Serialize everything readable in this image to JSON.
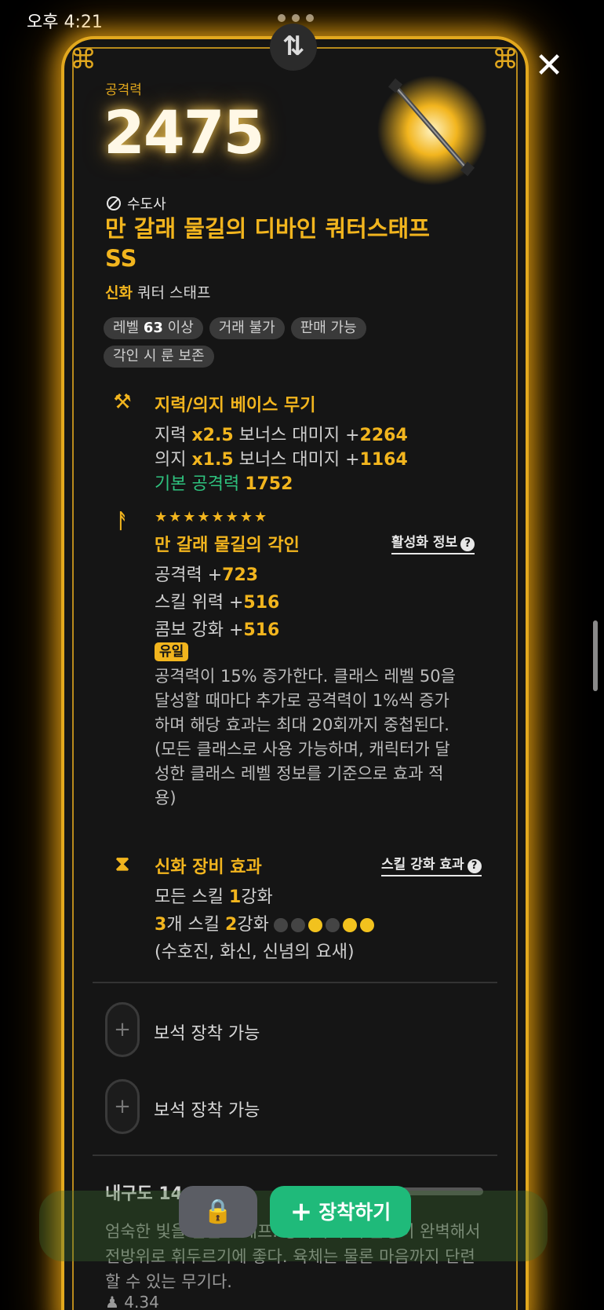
{
  "status_bar": {
    "time": "오후 4:21"
  },
  "header": {
    "swap_icon": "⇅",
    "close_icon": "✕",
    "corner_ornament": "⌘"
  },
  "item": {
    "attack_label": "공격력",
    "attack_value": "2475",
    "class_name": "수도사",
    "name": "만 갈래 물길의 디바인 쿼터스태프SS",
    "rarity": "신화",
    "type": "쿼터 스태프"
  },
  "tags": {
    "level_prefix": "레벨 ",
    "level_value": "63",
    "level_suffix": " 이상",
    "trade": "거래 불가",
    "sellable": "판매 가능",
    "rune_keep": "각인 시 룬 보존"
  },
  "base_weapon": {
    "icon": "⚒",
    "title": "지력/의지 베이스 무기",
    "line1_a": "지력 ",
    "line1_b": "x2.5",
    "line1_c": " 보너스 대미지 +",
    "line1_d": "2264",
    "line2_a": "의지 ",
    "line2_b": "x1.5",
    "line2_c": " 보너스 대미지 +",
    "line2_d": "1164",
    "line3_a": "기본 공격력 ",
    "line3_b": "1752"
  },
  "engraving": {
    "icon": "ᚨ",
    "stars": "★★★★★★★★",
    "title": "만 갈래 물길의 각인",
    "info_link": "활성화 정보",
    "help": "?",
    "stat1_a": "공격력 +",
    "stat1_b": "723",
    "stat2_a": "스킬 위력 +",
    "stat2_b": "516",
    "stat3_a": "콤보 강화 +",
    "stat3_b": "516",
    "unique_badge": "유일",
    "desc": "공격력이 15% 증가한다. 클래스 레벨 50을 달성할 때마다 추가로 공격력이 1%씩 증가하며 해당 효과는 최대 20회까지 중첩된다. (모든 클래스로 사용 가능하며, 캐릭터가 달성한 클래스 레벨 정보를 기준으로 효과 적용)"
  },
  "mythic_effect": {
    "icon": "⧗",
    "title": "신화 장비 효과",
    "info_link": "스킬 강화 효과",
    "help": "?",
    "line1_a": "모든 스킬 ",
    "line1_b": "1",
    "line1_c": "강화",
    "line2_a": "3",
    "line2_b": "개 스킬 ",
    "line2_c": "2",
    "line2_d": "강화",
    "gems": [
      false,
      false,
      true,
      false,
      true,
      true
    ],
    "skills": "(수호진, 화신, 신념의 요새)"
  },
  "sockets": [
    {
      "plus": "+",
      "label": "보석 장착 가능"
    },
    {
      "plus": "+",
      "label": "보석 장착 가능"
    }
  ],
  "durability": {
    "label": "내구도 14"
  },
  "flavor": "엄숙한 빛을 품은 스태프. 양쪽의 무게 균형이 완벽해서 전방위로 휘두르기에 좋다. 육체는 물론 마음까지 단련할 수 있는 무기다.",
  "weight": "4.34",
  "actions": {
    "lock_icon": "🔒",
    "equip_label": "장착하기",
    "equip_plus": "+"
  },
  "colors": {
    "gold": "#f2b51e",
    "green": "#1fba7a",
    "background": "#151515"
  }
}
